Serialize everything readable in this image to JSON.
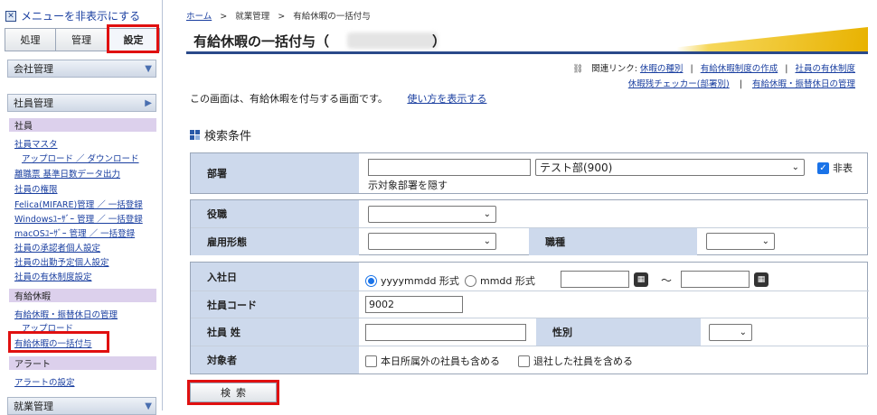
{
  "sidebar": {
    "hide_menu": "メニューを非表示にする",
    "tabs": [
      "処理",
      "管理",
      "設定"
    ],
    "sections": {
      "company": "会社管理",
      "employee": "社員管理",
      "work": "就業管理"
    },
    "arrows": {
      "down": "▼",
      "right": "▶"
    },
    "categories": {
      "employee": "社員",
      "paid_leave": "有給休暇",
      "alert": "アラート"
    },
    "employee_items": [
      "社員マスタ",
      "アップロード ／ ダウンロード",
      "離職票 基準日数データ出力",
      "社員の権限",
      "Felica(MIFARE)管理 ／ 一括登録",
      "Windowsﾕｰｻﾞｰ 管理 ／ 一括登録",
      "macOSﾕｰｻﾞｰ 管理 ／ 一括登録",
      "社員の承認者個人設定",
      "社員の出勤予定個人設定",
      "社員の有休制度設定"
    ],
    "paid_leave_items": [
      "有給休暇・振替休日の管理",
      "アップロード",
      "有給休暇の一括付与"
    ],
    "alert_items": [
      "アラートの設定"
    ]
  },
  "breadcrumb": {
    "home": "ホーム",
    "sep": ">",
    "work": "就業管理",
    "current": "有給休暇の一括付与"
  },
  "page": {
    "title": "有給休暇の一括付与（",
    "title_close": "）"
  },
  "related": {
    "label": "関連リンク:",
    "links_row1": [
      "休暇の種別",
      "有給休暇制度の作成",
      "社員の有休制度"
    ],
    "links_row2": [
      "休暇残チェッカー(部署別)",
      "有給休暇・振替休日の管理"
    ],
    "sep": "|"
  },
  "intro": {
    "text": "この画面は、有給休暇を付与する画面です。",
    "help_link": "使い方を表示する"
  },
  "search": {
    "title": "検索条件",
    "dept_label": "部署",
    "dept_value": "テスト部(900)",
    "hide_inactive": "非表",
    "hide_inactive_cont": "示対象部署を隠す",
    "position_label": "役職",
    "employment_label": "雇用形態",
    "job_label": "職種",
    "hire_label": "入社日",
    "fmt_ymd": "yyyymmdd 形式",
    "fmt_md": "mmdd 形式",
    "tilde": "～",
    "code_label": "社員コード",
    "code_value": "9002",
    "surname_label": "社員 姓",
    "gender_label": "性別",
    "target_label": "対象者",
    "include_other_dept": "本日所属外の社員も含める",
    "include_retired": "退社した社員を含める",
    "button": "検索"
  }
}
